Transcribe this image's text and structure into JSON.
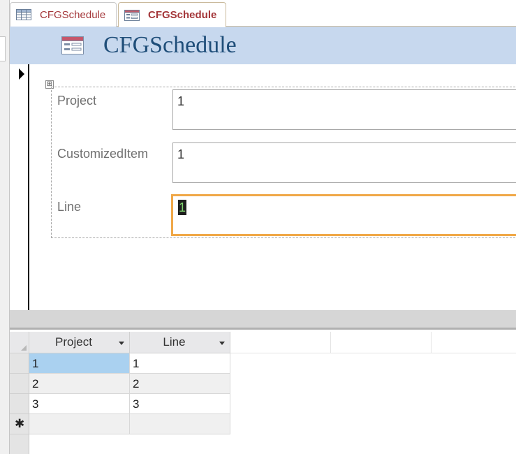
{
  "tabs": [
    {
      "label": "CFGSchedule",
      "icon": "table-icon",
      "active": false
    },
    {
      "label": "CFGSchedule",
      "icon": "form-icon",
      "active": true
    }
  ],
  "header": {
    "title": "CFGSchedule",
    "icon": "form-icon"
  },
  "form": {
    "fields": [
      {
        "label": "Project",
        "value": "1"
      },
      {
        "label": "CustomizedItem",
        "value": "1"
      },
      {
        "label": "Line",
        "value": "1"
      }
    ],
    "layout_handle": "⊞"
  },
  "datasheet": {
    "columns": [
      "Project",
      "Line"
    ],
    "rows": [
      [
        "1",
        "1"
      ],
      [
        "2",
        "2"
      ],
      [
        "3",
        "3"
      ]
    ],
    "new_row_marker": "✱"
  },
  "colors": {
    "header_band": "#c7d8ee",
    "title_text": "#1f4e79",
    "tab_text": "#a4373a",
    "focus_border": "#f0a848",
    "selected_cell": "#aad1f0"
  }
}
